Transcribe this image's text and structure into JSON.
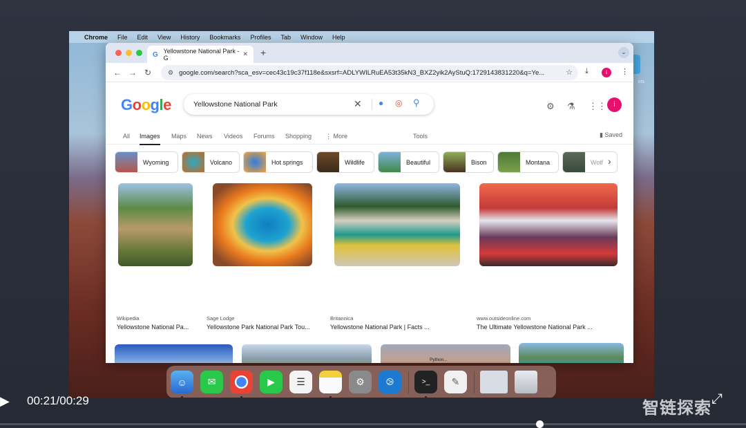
{
  "menubar": {
    "app": "Chrome",
    "items": [
      "File",
      "Edit",
      "View",
      "History",
      "Bookmarks",
      "Profiles",
      "Tab",
      "Window",
      "Help"
    ]
  },
  "desktop": {
    "icon_label": "ots"
  },
  "tab": {
    "title": "Yellowstone National Park - G"
  },
  "omnibox": {
    "url": "google.com/search?sca_esv=cec43c19c37f118e&sxsrf=ADLYWILRuEA53t35kN3_BXZ2yik2AyStuQ:1729143831220&q=Ye..."
  },
  "profile": {
    "initial": "i"
  },
  "search": {
    "query": "Yellowstone National Park"
  },
  "tabs": [
    "All",
    "Images",
    "Maps",
    "News",
    "Videos",
    "Forums",
    "Shopping",
    "⋮ More",
    "Tools"
  ],
  "saved": "Saved",
  "chips": [
    "Wyoming",
    "Volcano",
    "Hot springs",
    "Wildlife",
    "Beautiful",
    "Bison",
    "Montana",
    "Wolf"
  ],
  "results": [
    {
      "source": "Wikipedia",
      "title": "Yellowstone National Pa..."
    },
    {
      "source": "Sage Lodge",
      "title": "Yellowstone Park National Park Tou..."
    },
    {
      "source": "Britannica",
      "title": "Yellowstone National Park | Facts ..."
    },
    {
      "source": "www.outsideonline.com",
      "title": "The Ultimate Yellowstone National Park ..."
    }
  ],
  "dock": {
    "python_label": "Python..."
  },
  "video": {
    "time": "00:21/00:29",
    "watermark": "智链探索"
  },
  "colors": {
    "google_blue": "#4285f4",
    "google_red": "#ea4335",
    "google_yellow": "#fbbc05",
    "google_green": "#34a853",
    "profile_pink": "#e8106e"
  }
}
